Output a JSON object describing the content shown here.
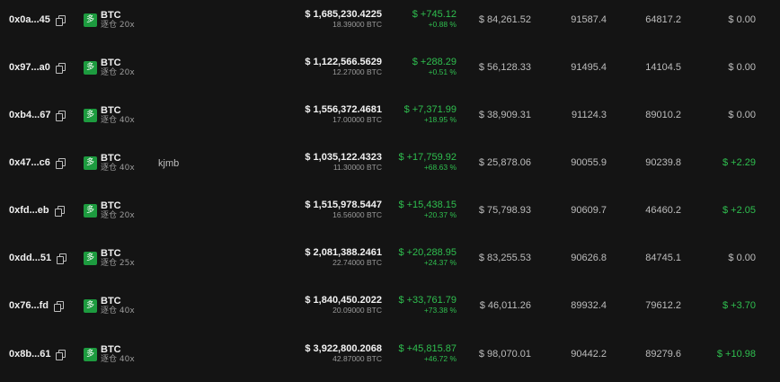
{
  "colors": {
    "background": "#141414",
    "positive": "#2fbf4f",
    "badge": "#1d9b3f",
    "text_primary": "#f0f0f0",
    "text_secondary": "#9a9a9a"
  },
  "icons": {
    "copy": "copy-icon",
    "direction": "long-badge"
  },
  "rows": [
    {
      "address": "0x0a...45",
      "side": "多",
      "coin": "BTC",
      "leverage": "逐仓 20x",
      "note": "",
      "value_usd": "$ 1,685,230.4225",
      "size": "18.39000 BTC",
      "pnl": "$ +745.12",
      "pnl_pct": "+0.88 %",
      "entry": "$ 84,261.52",
      "mark": "91587.4",
      "liq": "64817.2",
      "extra": "$ 0.00",
      "extra_positive": false
    },
    {
      "address": "0x97...a0",
      "side": "多",
      "coin": "BTC",
      "leverage": "逐仓 20x",
      "note": "",
      "value_usd": "$ 1,122,566.5629",
      "size": "12.27000 BTC",
      "pnl": "$ +288.29",
      "pnl_pct": "+0.51 %",
      "entry": "$ 56,128.33",
      "mark": "91495.4",
      "liq": "14104.5",
      "extra": "$ 0.00",
      "extra_positive": false
    },
    {
      "address": "0xb4...67",
      "side": "多",
      "coin": "BTC",
      "leverage": "逐仓 40x",
      "note": "",
      "value_usd": "$ 1,556,372.4681",
      "size": "17.00000 BTC",
      "pnl": "$ +7,371.99",
      "pnl_pct": "+18.95 %",
      "entry": "$ 38,909.31",
      "mark": "91124.3",
      "liq": "89010.2",
      "extra": "$ 0.00",
      "extra_positive": false
    },
    {
      "address": "0x47...c6",
      "side": "多",
      "coin": "BTC",
      "leverage": "逐仓 40x",
      "note": "kjmb",
      "value_usd": "$ 1,035,122.4323",
      "size": "11.30000 BTC",
      "pnl": "$ +17,759.92",
      "pnl_pct": "+68.63 %",
      "entry": "$ 25,878.06",
      "mark": "90055.9",
      "liq": "90239.8",
      "extra": "$ +2.29",
      "extra_positive": true
    },
    {
      "address": "0xfd...eb",
      "side": "多",
      "coin": "BTC",
      "leverage": "逐仓 20x",
      "note": "",
      "value_usd": "$ 1,515,978.5447",
      "size": "16.56000 BTC",
      "pnl": "$ +15,438.15",
      "pnl_pct": "+20.37 %",
      "entry": "$ 75,798.93",
      "mark": "90609.7",
      "liq": "46460.2",
      "extra": "$ +2.05",
      "extra_positive": true
    },
    {
      "address": "0xdd...51",
      "side": "多",
      "coin": "BTC",
      "leverage": "逐仓 25x",
      "note": "",
      "value_usd": "$ 2,081,388.2461",
      "size": "22.74000 BTC",
      "pnl": "$ +20,288.95",
      "pnl_pct": "+24.37 %",
      "entry": "$ 83,255.53",
      "mark": "90626.8",
      "liq": "84745.1",
      "extra": "$ 0.00",
      "extra_positive": false
    },
    {
      "address": "0x76...fd",
      "side": "多",
      "coin": "BTC",
      "leverage": "逐仓 40x",
      "note": "",
      "value_usd": "$ 1,840,450.2022",
      "size": "20.09000 BTC",
      "pnl": "$ +33,761.79",
      "pnl_pct": "+73.38 %",
      "entry": "$ 46,011.26",
      "mark": "89932.4",
      "liq": "79612.2",
      "extra": "$ +3.70",
      "extra_positive": true
    },
    {
      "address": "0x8b...61",
      "side": "多",
      "coin": "BTC",
      "leverage": "逐仓 40x",
      "note": "",
      "value_usd": "$ 3,922,800.2068",
      "size": "42.87000 BTC",
      "pnl": "$ +45,815.87",
      "pnl_pct": "+46.72 %",
      "entry": "$ 98,070.01",
      "mark": "90442.2",
      "liq": "89279.6",
      "extra": "$ +10.98",
      "extra_positive": true
    }
  ]
}
